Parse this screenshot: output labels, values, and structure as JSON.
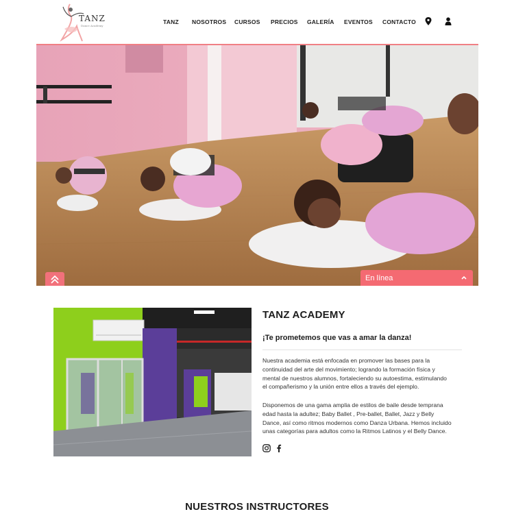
{
  "header": {
    "logo": {
      "text": "TANZ",
      "subtitle": "Dance Academy"
    },
    "nav": [
      {
        "label": "TANZ"
      },
      {
        "label": "NOSOTROS"
      },
      {
        "label": "CURSOS"
      },
      {
        "label": "PRECIOS"
      },
      {
        "label": "GALERÍA"
      },
      {
        "label": "EVENTOS"
      },
      {
        "label": "CONTACTO"
      }
    ],
    "icons": [
      "location-pin-icon",
      "user-icon"
    ]
  },
  "hero": {
    "image": "children-ballet-class-stretching-photo",
    "scroll_top_icon": "double-chevron-up-icon",
    "chat": {
      "label": "En línea",
      "icon": "chevron-up-icon"
    }
  },
  "about": {
    "image": "dance-studio-interior-photo",
    "title": "TANZ ACADEMY",
    "tagline": "¡Te prometemos que vas a amar la danza!",
    "paragraph1_lines": [
      "Nuestra academia está enfocada en promover las bases para la",
      "continuidad del arte del movimiento; logrando la formación física y",
      "mental de nuestros alumnos, fortaleciendo su autoestima, estimulando",
      "el compañerismo y la unión entre ellos a través del ejemplo."
    ],
    "paragraph2_lines": [
      "Disponemos de una gama amplia de estilos de baile desde temprana",
      "edad hasta la adultez; Baby Ballet , Pre-ballet, Ballet, Jazz y Belly",
      "Dance, así como ritmos modernos como Danza Urbana. Hemos incluido",
      "unas categorías para adultos como la Ritmos Latinos y el Belly Dance."
    ],
    "social": [
      "instagram-icon",
      "facebook-icon"
    ]
  },
  "instructors": {
    "title": "NUESTROS INSTRUCTORES"
  },
  "colors": {
    "accent": "#f46a72",
    "text": "#1d1d1d"
  }
}
